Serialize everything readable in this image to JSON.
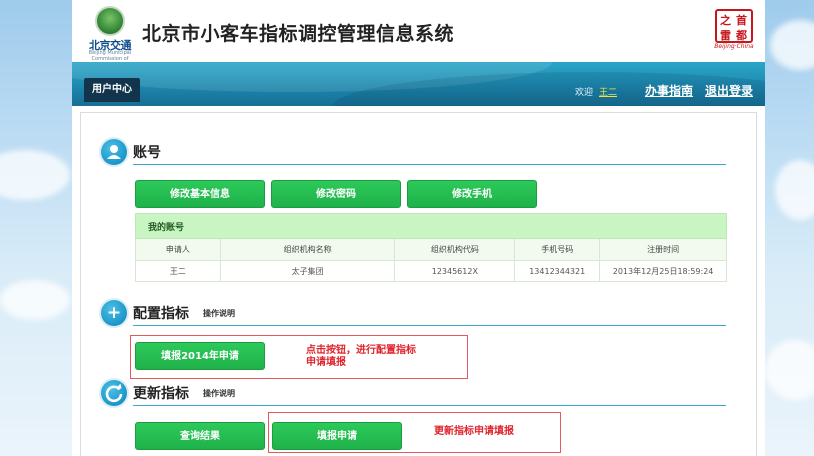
{
  "header": {
    "logo_text": "北京交通",
    "logo_sub": "Beijing Municipal Commission of Transport",
    "system_title": "北京市小客车指标调控管理信息系统",
    "badge_chars": [
      "之",
      "首",
      "雷",
      "都"
    ],
    "badge_sub": "Beijing·China"
  },
  "nav": {
    "tab_label": "用户中心",
    "welcome": "欢迎",
    "user_name": "王二",
    "guide_link": "办事指南",
    "logout_link": "退出登录"
  },
  "account": {
    "title": "账号",
    "buttons": {
      "edit_info": "修改基本信息",
      "edit_password": "修改密码",
      "edit_phone": "修改手机"
    },
    "table": {
      "caption": "我的账号",
      "headers": [
        "申请人",
        "组织机构名称",
        "组织机构代码",
        "手机号码",
        "注册时间"
      ],
      "rows": [
        [
          "王二",
          "太子集团",
          "12345612X",
          "13412344321",
          "2013年12月25日18:59:24"
        ]
      ]
    }
  },
  "config": {
    "title": "配置指标",
    "help": "操作说明",
    "button": "填报2014年申请",
    "note_line1": "点击按钮，进行配置指标",
    "note_line2": "申请填报"
  },
  "update": {
    "title": "更新指标",
    "help": "操作说明",
    "query_button": "查询结果",
    "apply_button": "填报申请",
    "note": "更新指标申请填报"
  },
  "colors": {
    "nav_bg": "#1b7ea4",
    "button_green": "#1fb24a",
    "table_caption_bg": "#c9f5c3",
    "section_icon": "#1a96c8",
    "note_red": "#e0232b"
  },
  "icons": {
    "account": "user-icon",
    "config": "plus-icon",
    "update": "refresh-icon"
  }
}
